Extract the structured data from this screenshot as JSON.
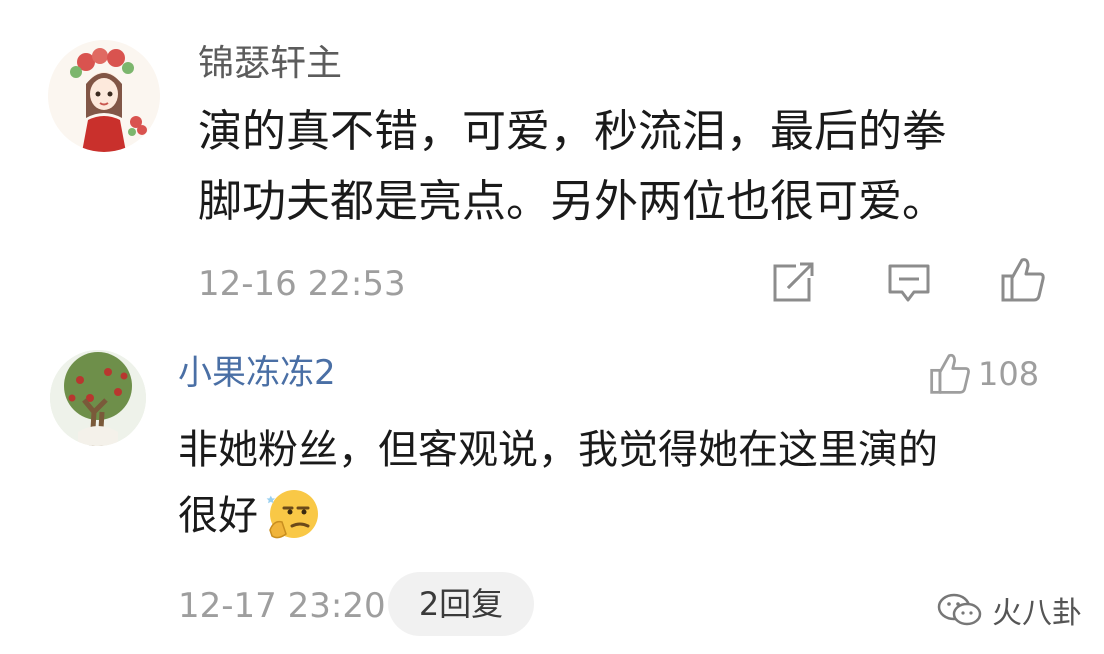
{
  "comment1": {
    "username": "锦瑟轩主",
    "text_lines": [
      "演的真不错，可爱，秒流泪，最后的拳",
      "脚功夫都是亮点。另外两位也很可爱。"
    ],
    "timestamp": "12-16 22:53",
    "actions": [
      "share-icon",
      "comment-icon",
      "like-icon"
    ]
  },
  "comment2": {
    "username": "小果冻冻2",
    "likes": "108",
    "text_lines": [
      "非她粉丝，但客观说，我觉得她在这里演的",
      "很好"
    ],
    "emoji": "thinking-face-emoji",
    "timestamp": "12-17 23:20",
    "separator": "·",
    "replies_label": "2回复"
  },
  "watermark": {
    "text": "火八卦"
  },
  "colors": {
    "username_blue": "#4a6fa5",
    "meta_gray": "#9e9e9e",
    "text": "#1a1a1a"
  }
}
